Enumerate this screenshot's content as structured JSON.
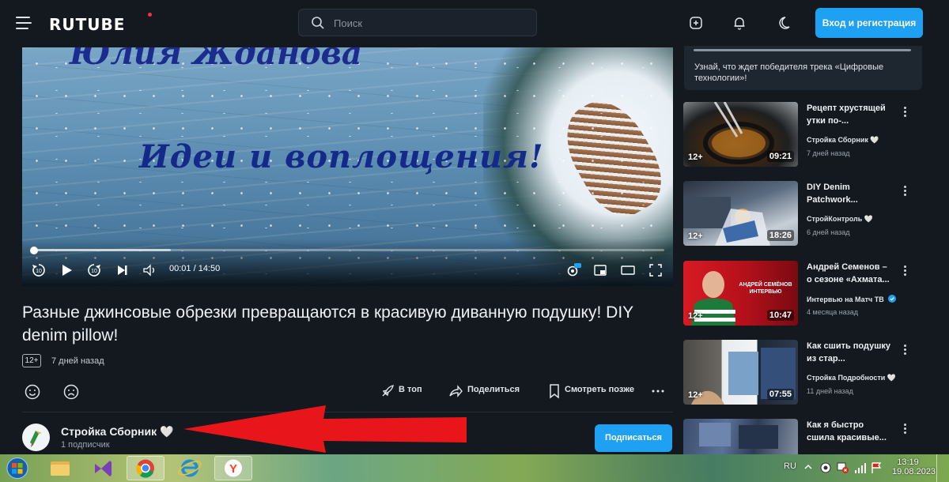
{
  "header": {
    "logo": "RUTUBE",
    "search_placeholder": "Поиск",
    "login_label": "Вход и регистрация"
  },
  "video": {
    "overlay_line1": "Юлия Жданова",
    "overlay_line2": "Идеи и воплощения!",
    "timecode": "00:01 / 14:50",
    "progress_fraction": 0.002,
    "buffered_fraction": 0.22,
    "rewind_seconds": "10",
    "forward_seconds": "10"
  },
  "info": {
    "title": "Разные джинсовые обрезки превращаются в красивую диванную подушку! DIY denim pillow!",
    "age_rating": "12+",
    "date": "7 дней назад",
    "actions": {
      "top": "В топ",
      "share": "Поделиться",
      "later": "Смотреть позже"
    }
  },
  "channel": {
    "name": "Стройка Сборник 🤍",
    "subscribers": "1 подписчик",
    "subscribe_label": "Подписаться"
  },
  "sidebar": {
    "promo_text": "Узнай, что ждет победителя трека «Цифровые технологии»!",
    "cards": [
      {
        "title": "Рецепт хрустящей утки по-...",
        "channel": "Стройка Сборник 🤍",
        "date": "7 дней назад",
        "age": "12+",
        "duration": "09:21"
      },
      {
        "title": "DIY Denim Patchwork...",
        "channel": "СтройКонтроль 🤍",
        "date": "6 дней назад",
        "age": "12+",
        "duration": "18:26"
      },
      {
        "title": "Андрей Семенов – о сезоне «Ахмата...",
        "channel": "Интервью на Матч ТВ",
        "date": "4 месяца назад",
        "age": "12+",
        "duration": "10:47",
        "thumb_text": "АНДРЕЙ СЕМЁНОВ ИНТЕРВЬЮ"
      },
      {
        "title": "Как сшить подушку из стар...",
        "channel": "Стройка Подробности 🤍",
        "date": "11 дней назад",
        "age": "12+",
        "duration": "07:55"
      },
      {
        "title": "Как я быстро сшила красивые...",
        "channel": "",
        "date": "",
        "age": "",
        "duration": ""
      }
    ]
  },
  "taskbar": {
    "lang": "RU",
    "time": "13:19",
    "date": "19.08.2023"
  },
  "colors": {
    "accent": "#1ea1f2",
    "background": "#14191f",
    "arrow": "#e8161b"
  }
}
